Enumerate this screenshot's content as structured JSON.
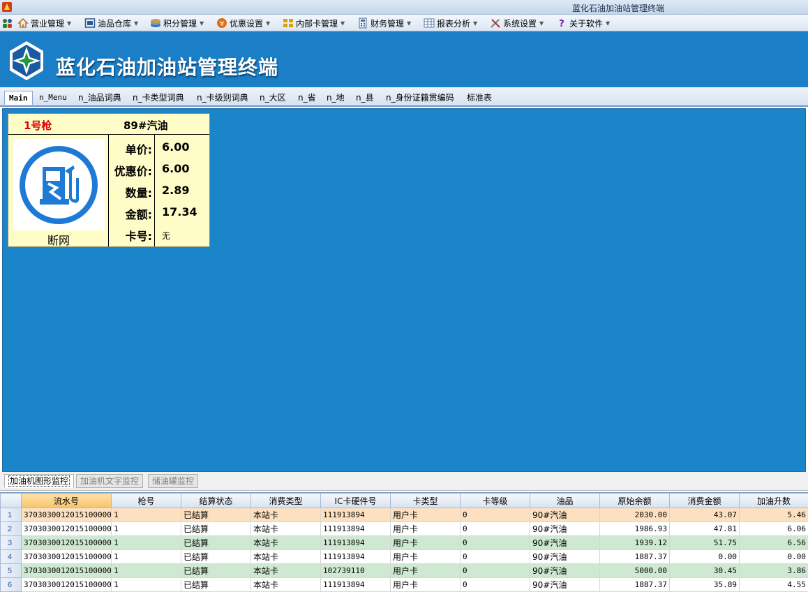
{
  "window": {
    "title": "蓝化石油加油站管理终端"
  },
  "menu": [
    {
      "label": "营业管理",
      "icon": "home-icon",
      "color": "#c07820"
    },
    {
      "label": "油品仓库",
      "icon": "warehouse-icon",
      "color": "#2d5b95"
    },
    {
      "label": "积分管理",
      "icon": "points-icon",
      "color": "#3a6fb0"
    },
    {
      "label": "优惠设置",
      "icon": "discount-icon",
      "color": "#e07010"
    },
    {
      "label": "内部卡管理",
      "icon": "card-icon",
      "color": "#d8a400"
    },
    {
      "label": "财务管理",
      "icon": "finance-icon",
      "color": "#4a6e9a"
    },
    {
      "label": "报表分析",
      "icon": "report-icon",
      "color": "#5a7ea8"
    },
    {
      "label": "系统设置",
      "icon": "tools-icon",
      "color": "#808080"
    },
    {
      "label": "关于软件",
      "icon": "help-icon",
      "color": "#7a1fa0"
    }
  ],
  "banner": {
    "title": "蓝化石油加油站管理终端"
  },
  "tabs": [
    "Main",
    "n_Menu",
    "n_油品词典",
    "n_卡类型词典",
    "n_卡级别词典",
    "n_大区",
    "n_省",
    "n_地",
    "n_县",
    "n_身份证籍贯编码",
    "标准表"
  ],
  "pump": {
    "gun": "1号枪",
    "fuel": "89#汽油",
    "status": "断网",
    "icon": "fuel-pump-icon",
    "unit_price_label": "单价:",
    "unit_price": "6.00",
    "discount_price_label": "优惠价:",
    "discount_price": "6.00",
    "quantity_label": "数量:",
    "quantity": "2.89",
    "amount_label": "金额:",
    "amount": "17.34",
    "card_label": "卡号:",
    "card": "无"
  },
  "subtabs": [
    "加油机图形监控",
    "加油机文字监控",
    "储油罐监控"
  ],
  "grid": {
    "columns": [
      "流水号",
      "枪号",
      "结算状态",
      "消费类型",
      "IC卡硬件号",
      "卡类型",
      "卡等级",
      "油品",
      "原始余额",
      "消费金额",
      "加油升数"
    ],
    "rows": [
      [
        "1",
        "37030300120151000000",
        "1",
        "已结算",
        "本站卡",
        "111913894",
        "用户卡",
        "0",
        "90#汽油",
        "2030.00",
        "43.07",
        "5.46"
      ],
      [
        "2",
        "37030300120151000000",
        "1",
        "已结算",
        "本站卡",
        "111913894",
        "用户卡",
        "0",
        "90#汽油",
        "1986.93",
        "47.81",
        "6.06"
      ],
      [
        "3",
        "37030300120151000000",
        "1",
        "已结算",
        "本站卡",
        "111913894",
        "用户卡",
        "0",
        "90#汽油",
        "1939.12",
        "51.75",
        "6.56"
      ],
      [
        "4",
        "37030300120151000000",
        "1",
        "已结算",
        "本站卡",
        "111913894",
        "用户卡",
        "0",
        "90#汽油",
        "1887.37",
        "0.00",
        "0.00"
      ],
      [
        "5",
        "37030300120151000000",
        "1",
        "已结算",
        "本站卡",
        "102739110",
        "用户卡",
        "0",
        "90#汽油",
        "5000.00",
        "30.45",
        "3.86"
      ],
      [
        "6",
        "37030300120151000000",
        "1",
        "已结算",
        "本站卡",
        "111913894",
        "用户卡",
        "0",
        "90#汽油",
        "1887.37",
        "35.89",
        "4.55"
      ]
    ]
  },
  "colors": {
    "banner": "#1a7fc6",
    "workspace": "#1a85c8",
    "card_bg": "#fffdc7",
    "gun_text": "#e00000",
    "row_selected": "#fde0c0",
    "row_alt": "#cfe8d2"
  }
}
